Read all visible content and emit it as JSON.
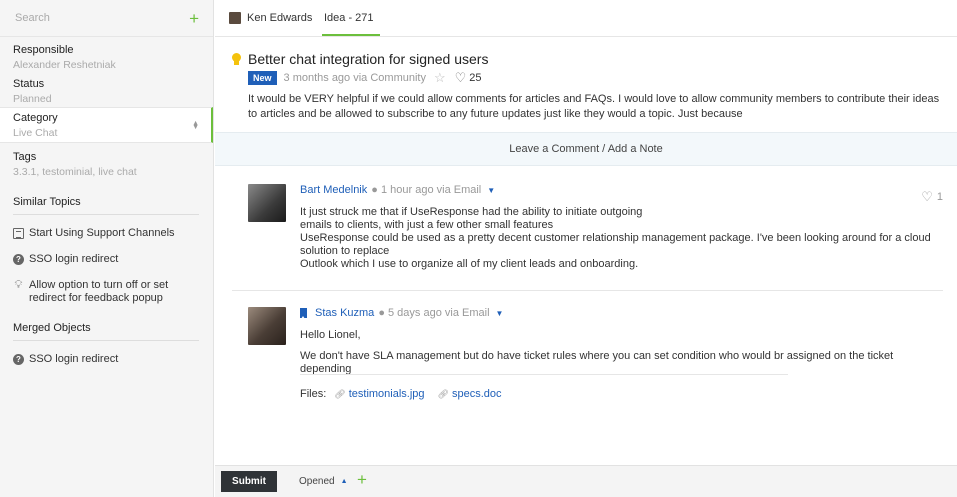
{
  "sidebar": {
    "search_placeholder": "Search",
    "responsible": {
      "label": "Responsible",
      "value": "Alexander Reshetniak"
    },
    "status": {
      "label": "Status",
      "value": "Planned"
    },
    "category": {
      "label": "Category",
      "value": "Live Chat"
    },
    "tags": {
      "label": "Tags",
      "value": "3.3.1, testominial, live chat"
    },
    "similar_title": "Similar Topics",
    "similar": [
      {
        "icon": "document-icon",
        "text": "Start Using Support Channels"
      },
      {
        "icon": "question-icon",
        "text": "SSO login redirect"
      },
      {
        "icon": "lightbulb-icon",
        "text": "Allow option to turn off or set redirect for feedback popup"
      }
    ],
    "merged_title": "Merged Objects",
    "merged": [
      {
        "icon": "question-icon",
        "text": "SSO login redirect"
      }
    ]
  },
  "tabs": {
    "user": "Ken Edwards",
    "idea": "Idea - 271"
  },
  "idea": {
    "title": "Better chat integration for signed users",
    "badge": "New",
    "meta": "3 months ago via Community",
    "likes": "25",
    "body": "It would be VERY helpful if we could allow comments for articles and FAQs. I would love to allow community members to contribute their ideas to articles and be allowed to subscribe to any future updates just like they would a topic. Just because"
  },
  "comment_bar": "Leave a Comment / Add a Note",
  "comments": [
    {
      "author": "Bart Medelnik",
      "meta": "● 1 hour ago via Email",
      "likes": "1",
      "lines": [
        "It just struck me that if UseResponse had the ability to initiate outgoing",
        "emails to clients, with just a few other small features",
        "UseResponse could be used as a pretty decent customer relationship management package. I've been looking around for a cloud solution to replace",
        "Outlook which I use to organize all of my client leads and onboarding."
      ]
    },
    {
      "author": "Stas Kuzma",
      "meta": "● 5 days ago via Email",
      "lines": [
        "Hello Lionel,",
        "We don't have SLA management but do have ticket rules where you can set condition who would br assigned on the ticket depending"
      ],
      "files_label": "Files:",
      "files": [
        "testimonials.jpg",
        "specs.doc"
      ]
    }
  ],
  "footer": {
    "submit": "Submit",
    "status": "Opened"
  },
  "colors": {
    "accent_green": "#6cbf3c",
    "link_blue": "#1f5fb8",
    "badge_blue": "#1f5fb8",
    "bulb_yellow": "#f4c20d"
  }
}
